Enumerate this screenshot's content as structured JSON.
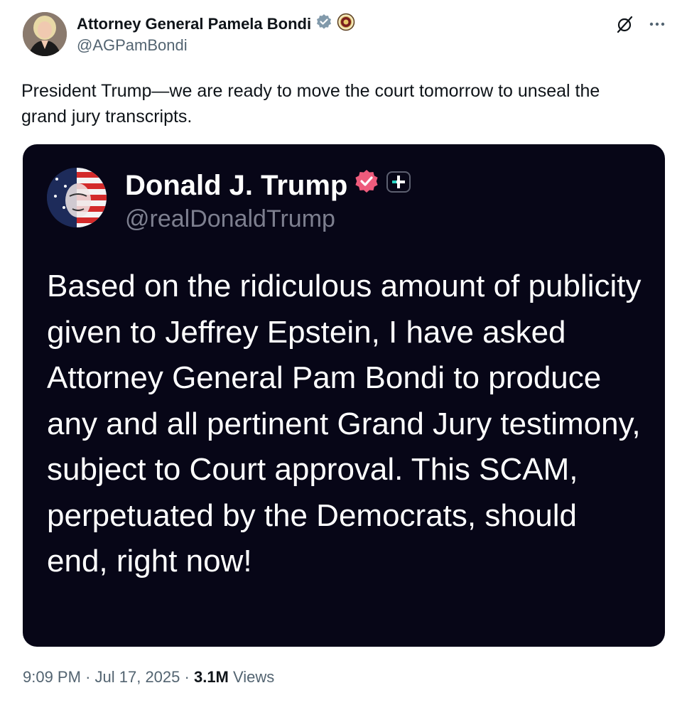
{
  "author": {
    "name": "Attorney General Pamela Bondi",
    "handle": "@AGPamBondi",
    "verified_color": "#829aab"
  },
  "header_icons": [
    "grok-icon",
    "more-options-icon"
  ],
  "tweet": {
    "text": "President Trump—we are ready to move the court tomorrow to unseal the grand jury transcripts."
  },
  "quoted": {
    "name": "Donald J. Trump",
    "handle": "@realDonaldTrump",
    "body": "Based on the ridiculous amount of publicity given to Jeffrey Epstein, I have asked Attorney General Pam Bondi to produce any and all pertinent Grand Jury testimony, subject to Court approval. This SCAM, perpetuated by the Democrats, should end, right now!",
    "badge_color": "#ee5b7c",
    "background": "#070617"
  },
  "meta": {
    "time": "9:09 PM",
    "date": "Jul 17, 2025",
    "views_count": "3.1M",
    "views_label": "Views",
    "sep": "·"
  }
}
